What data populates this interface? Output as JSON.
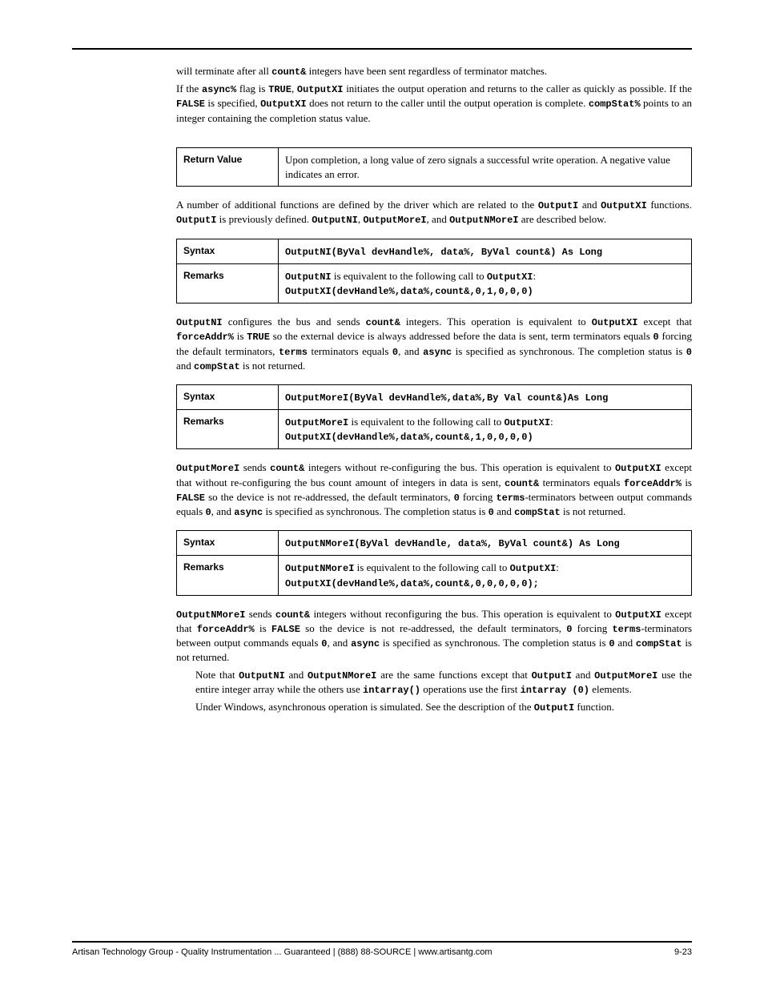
{
  "intro_para_pre": "will terminate after all ",
  "intro_count": "count&",
  "intro_para_post": " integers have been sent regardless of terminator matches.",
  "para2_a": "If the ",
  "para2_async": "async%",
  "para2_b": " flag is ",
  "para2_true": "TRUE",
  "para2_c": ", ",
  "para2_ox1": "OutputXI",
  "para2_d": " initiates the output operation and returns to the caller as quickly as possible. If the ",
  "para2_false": "FALSE",
  "para2_e": " is specified, ",
  "para2_ox2": "OutputXI",
  "para2_f": " does not return to the caller until the output operation is complete. ",
  "para2_compstat": "compStat%",
  "para2_g": " points to an integer containing the completion status value.",
  "returnvalue_label": "Return Value",
  "returnvalue_text": "Upon completion, a long value of zero signals a successful write operation. A negative value indicates an error.",
  "related_a": "A number of additional functions are defined by the driver which are related to the ",
  "related_oi": "OutputI",
  "related_b": " and ",
  "related_oxi": "OutputXI",
  "related_c": " functions. ",
  "related_oi2": "OutputI",
  "related_d": " is previously defined. ",
  "related_oni": "OutputNI",
  "related_e": ", ",
  "related_omi": "OutputMoreI",
  "related_f": ", and ",
  "related_onmi": "OutputNMoreI",
  "related_g": " are described below.",
  "tbl1_synlabel": "Syntax",
  "tbl1_syntax": "OutputNI(ByVal devHandle%, data%, ByVal count&) As Long",
  "tbl1_remlabel": "Remarks",
  "tbl1_rem_a": "OutputNI",
  "tbl1_rem_b": " is equivalent to the following call to ",
  "tbl1_rem_c": "OutputXI",
  "tbl1_rem_d": ": ",
  "tbl1_rem_code": "OutputXI(devHandle%,data%,count&,0,1,0,0,0)",
  "p1_a": "OutputNI",
  "p1_b": " configures the bus and sends ",
  "p1_count": "count&",
  "p1_c": " integers. This operation is equivalent to ",
  "p1_d": "OutputXI",
  "p1_e": " except that ",
  "p1_fa": "forceAddr%",
  "p1_f": " is ",
  "p1_true": "TRUE",
  "p1_g": " so the external device is always addressed before the data is sent, term terminators equals ",
  "p1_zero1": "0",
  "p1_h": " forcing the default terminators, ",
  "p1_terms": "terms",
  "p1_i": " terminators equals ",
  "p1_zero2": "0",
  "p1_j": ", and ",
  "p1_async": "async",
  "p1_k": " is specified as synchronous. The completion status is ",
  "p1_zero3": "0",
  "p1_l": " and ",
  "p1_cs": "compStat",
  "p1_m": " is not returned.",
  "tbl2_synlabel": "Syntax",
  "tbl2_syntax": "OutputMoreI(ByVal devHandle%,data%,By Val count&)As Long",
  "tbl2_remlabel": "Remarks",
  "tbl2_rem_a": "OutputMoreI",
  "tbl2_rem_b": " is equivalent to the following call to ",
  "tbl2_rem_c": "OutputXI",
  "tbl2_rem_d": ": ",
  "tbl2_rem_code": "OutputXI(devHandle%,data%,count&,1,0,0,0,0)",
  "p2_a": "OutputMoreI",
  "p2_b": " sends ",
  "p2_count": "count&",
  "p2_c": " integers without re-configuring the bus. This operation is equivalent to ",
  "p2_d": "OutputXI",
  "p2_e": " except that without re-configuring the bus count amount of integers in data is sent, ",
  "p2_countb": "count&",
  "p2_f": " terminators equals ",
  "p2_fa": "forceAddr%",
  "p2_g": " is ",
  "p2_false": "FALSE",
  "p2_h": " so the device is not re-addressed, the default terminators, ",
  "p2_zero1": "0",
  "p2_i": " forcing ",
  "p2_terms": "terms",
  "p2_j": "-terminators between output commands equals ",
  "p2_zero2": "0",
  "p2_k": ", and ",
  "p2_async": "async",
  "p2_l": " is specified as synchronous. The completion status is ",
  "p2_zero3": "0",
  "p2_m": " and ",
  "p2_cs": "compStat",
  "p2_n": " is not returned.",
  "tbl3_synlabel": "Syntax",
  "tbl3_syntax": "OutputNMoreI(ByVal devHandle, data%, ByVal count&) As Long",
  "tbl3_remlabel": "Remarks",
  "tbl3_rem_a": "OutputNMoreI",
  "tbl3_rem_b": " is equivalent to the following call to ",
  "tbl3_rem_c": "OutputXI",
  "tbl3_rem_d": ": ",
  "tbl3_rem_code": "OutputXI(devHandle%,data%,count&,0,0,0,0,0);",
  "p3_a": "OutputNMoreI",
  "p3_b": " sends ",
  "p3_count": "count&",
  "p3_c": " integers without reconfiguring the bus. This operation is equivalent to ",
  "p3_ox": "OutputXI",
  "p3_d": " except that ",
  "p3_fa": "forceAddr%",
  "p3_e": " is ",
  "p3_false": "FALSE",
  "p3_f": " so the device is not re-addressed, the default terminators, ",
  "p3_zero1": "0",
  "p3_g": " forcing ",
  "p3_terms": "terms",
  "p3_h": "-terminators between output commands equals ",
  "p3_zero2": "0",
  "p3_i": ", and ",
  "p3_async": "async",
  "p3_j": " is specified as synchronous. The completion status is ",
  "p3_zero3": "0",
  "p3_k": " and ",
  "p3_cs": "compStat",
  "p3_l": " is not returned.",
  "note_a": "Note that ",
  "note_oni": "OutputNI",
  "note_b": " and ",
  "note_onmi": "OutputNMoreI",
  "note_c": " are the same functions except that ",
  "note_oi": "OutputI",
  "note_d": " and ",
  "note_omi": "OutputMoreI",
  "note_e": " use the entire integer array while the others use ",
  "note_ia": "intarray()",
  "note_f": " operations use the first ",
  "note_ia0": "intarray (0)",
  "note_g": " elements.",
  "final_a": "Under Windows, asynchronous operation is simulated. See the description of the ",
  "final_oi": "OutputI",
  "final_b": " function.",
  "footer_left": "Artisan Technology Group - Quality Instrumentation ... Guaranteed | (888) 88-SOURCE | www.artisantg.com",
  "footer_page": "9-23"
}
